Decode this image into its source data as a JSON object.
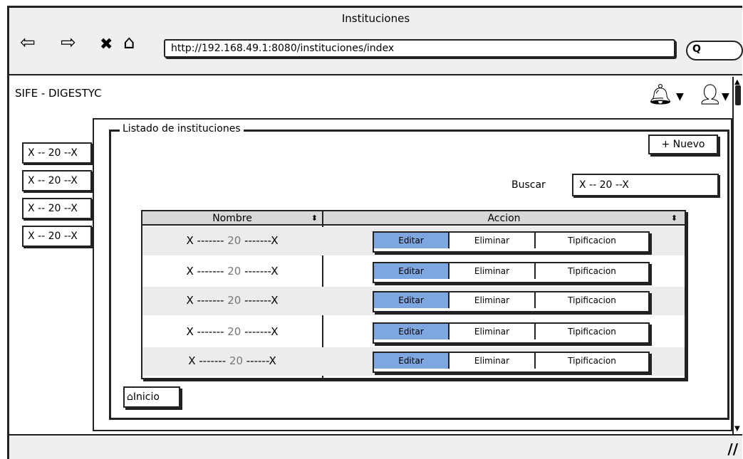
{
  "window": {
    "title": "Instituciones"
  },
  "nav": {
    "back": "⇦",
    "forward": "⇨",
    "stop": "✖",
    "home": "⌂"
  },
  "browser": {
    "url": "http://192.168.49.1:8080/instituciones/index",
    "search_glyph": "Q"
  },
  "app": {
    "brand": "SIFE - DIGESTYC"
  },
  "sidebar": {
    "items": [
      {
        "label": "X -- 20 --X"
      },
      {
        "label": "X -- 20 --X"
      },
      {
        "label": "X -- 20 --X"
      },
      {
        "label": "X -- 20 --X"
      }
    ]
  },
  "panel": {
    "legend": "Listado de instituciones",
    "new_button": "+ Nuevo",
    "search_label": "Buscar",
    "search_value": "X -- 20 --X",
    "home_button": "Inicio"
  },
  "table": {
    "headers": {
      "name": "Nombre",
      "action": "Accion"
    },
    "rows": [
      {
        "pre": "X ------- ",
        "mid": "20",
        "post": " -------X"
      },
      {
        "pre": "X ------- ",
        "mid": "20",
        "post": " -------X"
      },
      {
        "pre": "X ------- ",
        "mid": "20",
        "post": " -------X"
      },
      {
        "pre": "X ------- ",
        "mid": "20",
        "post": " -------X"
      },
      {
        "pre": "X ------- ",
        "mid": "20",
        "post": " ------X"
      }
    ],
    "actions": {
      "edit": "Editar",
      "delete": "Eliminar",
      "tipificar": "Tipificacion"
    }
  },
  "colors": {
    "accent": "#7ea6e0",
    "header_bg": "#d8d8d8",
    "row_alt": "#ececec"
  }
}
